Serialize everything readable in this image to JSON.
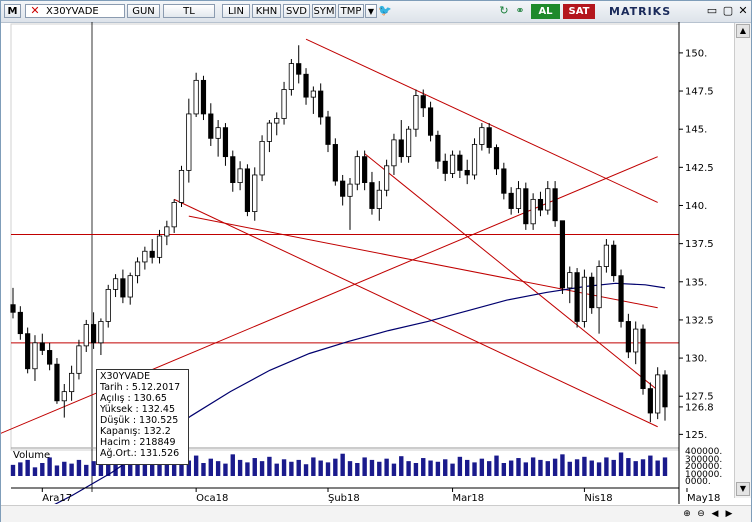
{
  "toolbar": {
    "logo": "M",
    "symbol": "X30YVADE",
    "period": "GUN",
    "chart_mode": "TL",
    "scale_buttons": [
      "LIN",
      "KHN",
      "SVD",
      "SYM",
      "TMP"
    ],
    "buy_label": "AL",
    "sell_label": "SAT",
    "brand": "MATRIKS"
  },
  "info_box": {
    "symbol": "X30YVADE",
    "rows": [
      "Tarih : 5.12.2017",
      "Açılış : 130.65",
      "Yüksek : 132.45",
      "Düşük : 130.525",
      "Kapanış: 132.2",
      "Hacim : 218849",
      "Ağ.Ort.: 131.526"
    ]
  },
  "volume": {
    "label": "Volume",
    "ticks": [
      "400000.",
      "300000.",
      "200000.",
      "100000.",
      "0000."
    ]
  },
  "colors": {
    "up_candle": "#ffffff",
    "down_candle": "#000000",
    "trend_lines": "#c00000",
    "moving_average": "#00006e",
    "volume_bars": "#1a1a8c",
    "buy": "#1f8a2b",
    "sell": "#b4161d"
  },
  "chart_data": {
    "type": "candlestick",
    "y_ticks": [
      "150.",
      "147.5",
      "145.",
      "142.5",
      "140.",
      "137.5",
      "135.",
      "132.5",
      "130.",
      "127.5",
      "126.8",
      "125."
    ],
    "ylim": [
      124.5,
      151.5
    ],
    "x_ticks": [
      "Ara17",
      "Oca18",
      "Şub18",
      "Mar18",
      "Nis18",
      "May18"
    ],
    "last_price": 126.8,
    "horizontal_levels": [
      138.1,
      131.0
    ],
    "moving_average": [
      [
        0,
        119
      ],
      [
        30,
        121
      ],
      [
        50,
        122.5
      ],
      [
        70,
        124.3
      ],
      [
        90,
        126.2
      ],
      [
        110,
        127.8
      ],
      [
        130,
        129.2
      ],
      [
        150,
        130.3
      ],
      [
        170,
        131.1
      ],
      [
        190,
        131.8
      ],
      [
        210,
        132.4
      ],
      [
        230,
        133.1
      ],
      [
        250,
        133.8
      ],
      [
        270,
        134.3
      ],
      [
        290,
        134.7
      ],
      [
        305,
        134.9
      ],
      [
        320,
        134.8
      ],
      [
        330,
        134.6
      ]
    ],
    "candles": [
      [
        133.5,
        134.6,
        132.6,
        133.0
      ],
      [
        133.0,
        133.4,
        131.2,
        131.6
      ],
      [
        131.6,
        132.0,
        129.0,
        129.3
      ],
      [
        129.3,
        131.5,
        128.5,
        131.0
      ],
      [
        131.0,
        131.6,
        130.2,
        130.5
      ],
      [
        130.5,
        131.0,
        129.2,
        129.6
      ],
      [
        129.6,
        130.0,
        127.0,
        127.2
      ],
      [
        127.2,
        128.3,
        126.1,
        127.8
      ],
      [
        127.8,
        129.5,
        127.2,
        129.0
      ],
      [
        129.0,
        131.2,
        128.6,
        130.8
      ],
      [
        130.8,
        132.5,
        130.4,
        132.2
      ],
      [
        132.2,
        133.0,
        130.6,
        131.0
      ],
      [
        131.0,
        132.6,
        130.2,
        132.4
      ],
      [
        132.4,
        134.8,
        132.0,
        134.5
      ],
      [
        134.5,
        135.5,
        134.0,
        135.2
      ],
      [
        135.2,
        135.8,
        133.6,
        134.0
      ],
      [
        134.0,
        135.6,
        133.5,
        135.4
      ],
      [
        135.4,
        136.6,
        134.9,
        136.3
      ],
      [
        136.3,
        137.3,
        135.8,
        137.0
      ],
      [
        137.0,
        137.8,
        136.2,
        136.6
      ],
      [
        136.6,
        138.4,
        136.2,
        138.0
      ],
      [
        138.0,
        139.0,
        137.4,
        138.6
      ],
      [
        138.6,
        140.4,
        138.2,
        140.2
      ],
      [
        140.2,
        142.6,
        139.9,
        142.3
      ],
      [
        142.3,
        147.0,
        141.5,
        146.0
      ],
      [
        146.0,
        148.7,
        145.8,
        148.2
      ],
      [
        148.2,
        148.5,
        145.6,
        146.0
      ],
      [
        146.0,
        146.7,
        143.9,
        144.4
      ],
      [
        144.4,
        145.6,
        143.2,
        145.1
      ],
      [
        145.1,
        145.4,
        142.6,
        143.2
      ],
      [
        143.2,
        143.6,
        140.9,
        141.5
      ],
      [
        141.5,
        142.9,
        141.0,
        142.4
      ],
      [
        142.4,
        142.7,
        139.3,
        139.6
      ],
      [
        139.6,
        142.5,
        139.0,
        142.0
      ],
      [
        142.0,
        144.6,
        141.6,
        144.2
      ],
      [
        144.2,
        145.6,
        143.5,
        145.4
      ],
      [
        145.4,
        146.1,
        144.6,
        145.7
      ],
      [
        145.7,
        148.1,
        145.3,
        147.6
      ],
      [
        147.6,
        149.6,
        147.2,
        149.3
      ],
      [
        149.3,
        150.5,
        148.0,
        148.6
      ],
      [
        148.6,
        149.0,
        146.6,
        147.1
      ],
      [
        147.1,
        147.8,
        146.0,
        147.5
      ],
      [
        147.5,
        148.0,
        145.3,
        145.8
      ],
      [
        145.8,
        146.2,
        143.5,
        144.0
      ],
      [
        144.0,
        144.4,
        141.3,
        141.6
      ],
      [
        141.6,
        142.0,
        140.0,
        140.6
      ],
      [
        140.6,
        141.8,
        138.4,
        141.4
      ],
      [
        141.4,
        143.6,
        141.0,
        143.2
      ],
      [
        143.2,
        143.6,
        141.0,
        141.5
      ],
      [
        141.5,
        142.2,
        139.4,
        139.8
      ],
      [
        139.8,
        141.6,
        139.0,
        141.0
      ],
      [
        141.0,
        143.0,
        140.6,
        142.6
      ],
      [
        142.6,
        144.7,
        142.0,
        144.3
      ],
      [
        144.3,
        145.6,
        142.8,
        143.2
      ],
      [
        143.2,
        145.2,
        142.8,
        145.0
      ],
      [
        145.0,
        147.6,
        144.5,
        147.2
      ],
      [
        147.2,
        147.6,
        145.8,
        146.4
      ],
      [
        146.4,
        146.8,
        144.2,
        144.6
      ],
      [
        144.6,
        144.9,
        142.4,
        142.9
      ],
      [
        142.9,
        143.4,
        141.6,
        142.1
      ],
      [
        142.1,
        143.6,
        141.8,
        143.3
      ],
      [
        143.3,
        143.6,
        141.8,
        142.3
      ],
      [
        142.3,
        143.0,
        141.4,
        142.0
      ],
      [
        142.0,
        144.4,
        141.7,
        144.0
      ],
      [
        144.0,
        145.4,
        143.6,
        145.1
      ],
      [
        145.1,
        145.4,
        143.4,
        143.8
      ],
      [
        143.8,
        144.0,
        142.0,
        142.4
      ],
      [
        142.4,
        142.8,
        140.4,
        140.8
      ],
      [
        140.8,
        141.2,
        139.4,
        139.8
      ],
      [
        139.8,
        141.6,
        139.5,
        141.1
      ],
      [
        141.1,
        141.5,
        138.4,
        138.8
      ],
      [
        138.8,
        140.8,
        138.4,
        140.4
      ],
      [
        140.4,
        140.9,
        139.3,
        139.7
      ],
      [
        139.7,
        141.6,
        139.4,
        141.1
      ],
      [
        141.1,
        141.6,
        138.6,
        139.0
      ],
      [
        139.0,
        138.9,
        134.2,
        134.6
      ],
      [
        134.6,
        136.0,
        133.6,
        135.6
      ],
      [
        135.6,
        135.9,
        132.0,
        132.4
      ],
      [
        132.4,
        135.8,
        132.0,
        135.3
      ],
      [
        135.3,
        135.6,
        132.9,
        133.3
      ],
      [
        133.3,
        136.4,
        131.6,
        136.0
      ],
      [
        136.0,
        137.8,
        135.6,
        137.4
      ],
      [
        137.4,
        137.7,
        135.0,
        135.4
      ],
      [
        135.4,
        135.8,
        132.0,
        132.4
      ],
      [
        132.4,
        132.9,
        130.0,
        130.4
      ],
      [
        130.4,
        132.4,
        129.6,
        131.9
      ],
      [
        131.9,
        132.2,
        127.6,
        128.0
      ],
      [
        128.0,
        128.4,
        125.8,
        126.4
      ],
      [
        126.4,
        129.4,
        126.0,
        128.9
      ],
      [
        128.9,
        129.2,
        125.9,
        126.8
      ]
    ],
    "volumes": [
      180000,
      220000,
      260000,
      140000,
      210000,
      300000,
      170000,
      230000,
      200000,
      260000,
      180000,
      240000,
      210000,
      320000,
      190000,
      260000,
      230000,
      180000,
      280000,
      240000,
      200000,
      310000,
      270000,
      190000,
      250000,
      330000,
      210000,
      280000,
      240000,
      200000,
      350000,
      260000,
      220000,
      290000,
      240000,
      310000,
      200000,
      270000,
      230000,
      260000,
      190000,
      300000,
      250000,
      220000,
      280000,
      360000,
      240000,
      210000,
      300000,
      260000,
      230000,
      280000,
      200000,
      320000,
      240000,
      210000,
      290000,
      250000,
      230000,
      270000,
      200000,
      310000,
      260000,
      220000,
      280000,
      240000,
      330000,
      210000,
      250000,
      290000,
      220000,
      300000,
      260000,
      240000,
      280000,
      350000,
      230000,
      270000,
      310000,
      250000,
      220000,
      300000,
      260000,
      380000,
      290000,
      240000,
      270000,
      330000,
      250000,
      300000
    ]
  }
}
